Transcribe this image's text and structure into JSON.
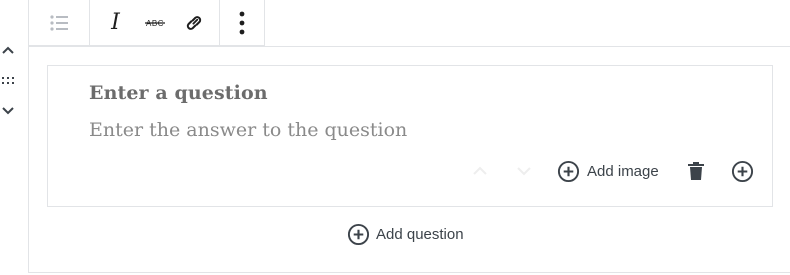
{
  "toolbar": {
    "list_icon": "list-icon",
    "italic_glyph": "I",
    "strikethrough_icon": "strikethrough-icon",
    "link_icon": "link-icon",
    "more_icon": "more-vertical-icon"
  },
  "mover": {
    "up_icon": "chevron-up-icon",
    "drag_icon": "drag-handle-icon",
    "down_icon": "chevron-down-icon"
  },
  "faq": {
    "question_placeholder": "Enter a question",
    "answer_placeholder": "Enter the answer to the question",
    "add_image_label": "Add image",
    "add_question_label": "Add question"
  },
  "colors": {
    "border": "#e2e4e7",
    "question_text": "#6c6c6c",
    "answer_text": "#8a8a8a",
    "icon": "#3c434a",
    "faint_icon": "#eeeeee"
  }
}
